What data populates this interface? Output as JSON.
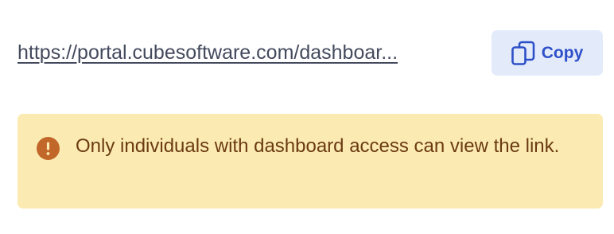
{
  "share": {
    "url": "https://portal.cubesoftware.com/dashboar...",
    "copy_label": "Copy",
    "copy_icon": "copy-icon"
  },
  "alert": {
    "icon": "exclamation-circle-icon",
    "message": "Only individuals with dashboard access can view the link."
  },
  "colors": {
    "link_text": "#444a5e",
    "copy_button_bg": "#e3ebfb",
    "copy_button_text": "#2d50c8",
    "alert_bg": "#fbebb2",
    "alert_text": "#6b3a12",
    "alert_icon": "#c2672a"
  }
}
